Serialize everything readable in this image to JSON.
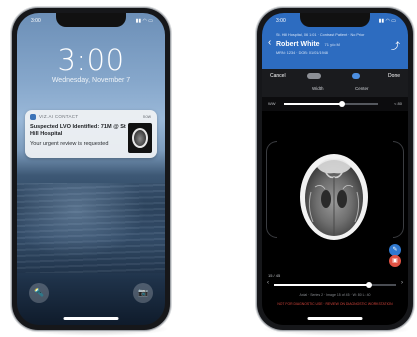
{
  "left_phone": {
    "status_time": "3:00",
    "status_icons": "▮▮ ◠ ▭",
    "lock_time": "3:00",
    "lock_date": "Wednesday, November 7",
    "notification": {
      "app": "VIZ.AI CONTACT",
      "when": "now",
      "title": "Suspected LVO Identified: 71M @ St Hill Hospital",
      "body": "Your urgent review is requested"
    },
    "buttons": {
      "flashlight": "🔦",
      "camera": "📷"
    }
  },
  "right_phone": {
    "status_time": "3:00",
    "status_icons": "▮▮ ◠ ▭",
    "header": {
      "back": "‹",
      "meta": "St. Hill Hospital, 06 1:01 · Contrast Patient · No Prior",
      "patient_name": "Robert White",
      "patient_sub": "71 y/o M",
      "ids": "MRN: 1234 · DOB: 01/01/1948",
      "share": "⤴"
    },
    "toolbar": {
      "cancel": "Cancel",
      "done": "Done",
      "window_label": "Width",
      "center_label": "Center"
    },
    "window_slider": {
      "label": "WW",
      "value": "< 80",
      "fraction": 0.62
    },
    "slice_slider": {
      "label": "15 / 45",
      "fraction": 0.78
    },
    "actions": [
      {
        "icon": "✎",
        "color": "#2f78cf"
      },
      {
        "icon": "✆",
        "color": "#33b06a"
      },
      {
        "icon": "▣",
        "color": "#e05243"
      }
    ],
    "footer_text": "Axial · Series 2 · Image 15 of 45 · W: 80 L: 40",
    "warning": "NOT FOR DIAGNOSTIC USE · REVIEW ON DIAGNOSTIC WORKSTATION"
  }
}
